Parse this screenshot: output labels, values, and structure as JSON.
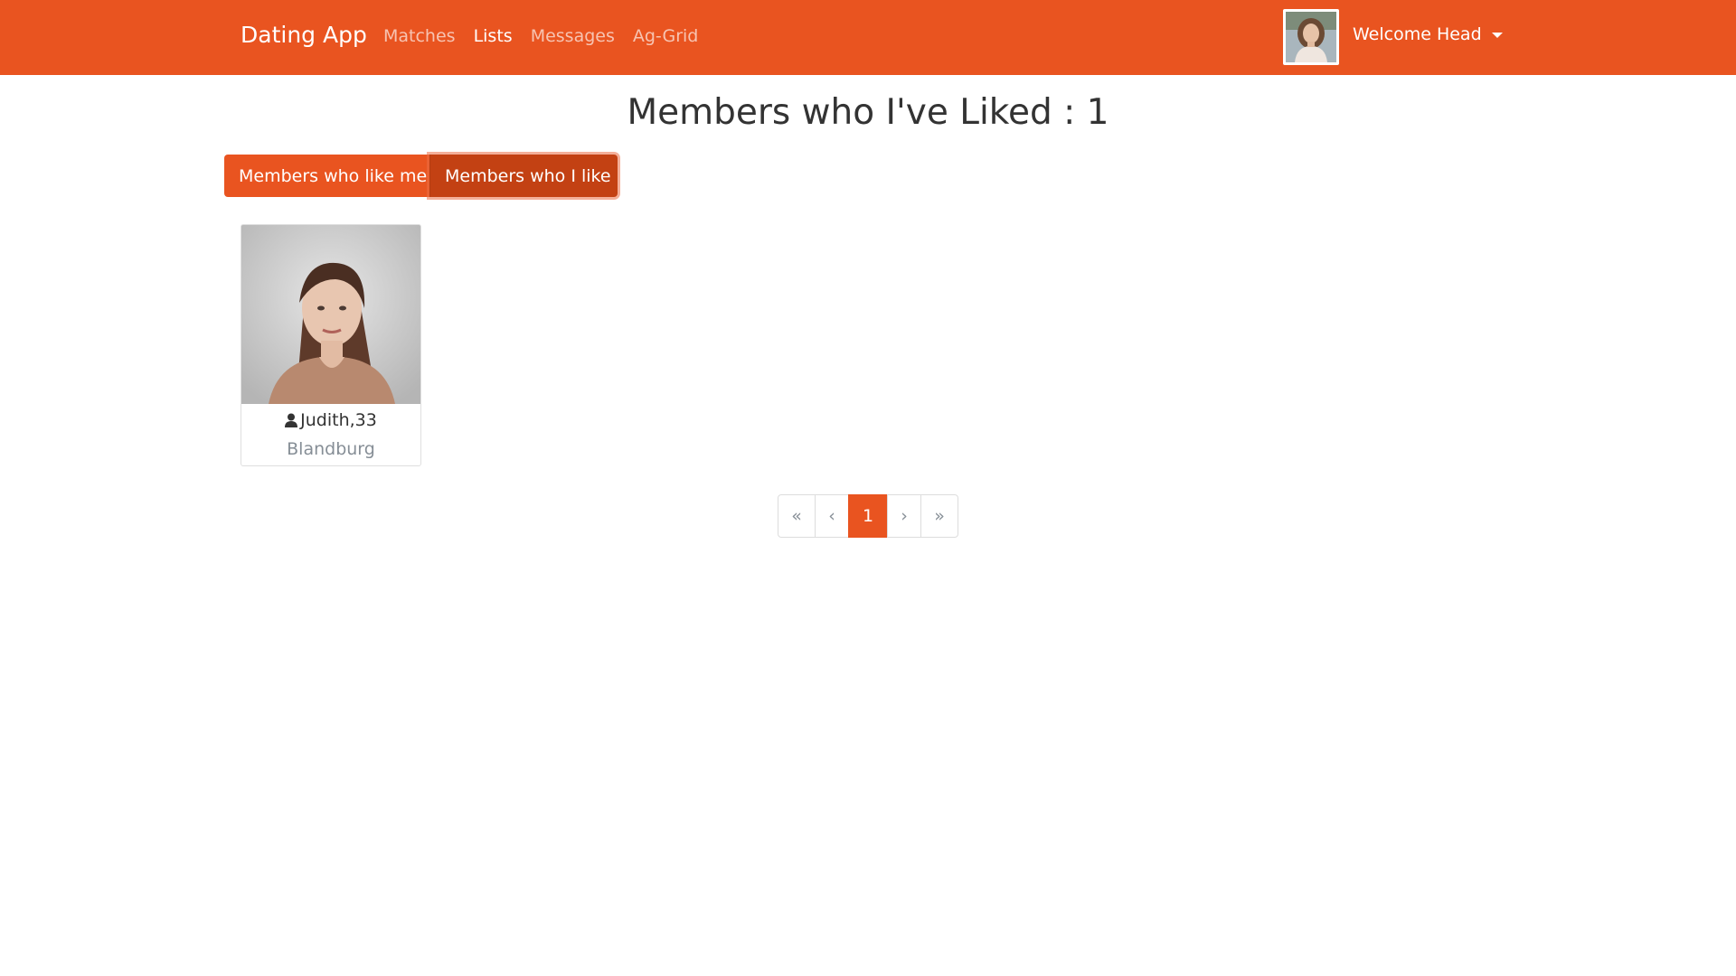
{
  "navbar": {
    "brand": "Dating App",
    "links": [
      {
        "label": "Matches",
        "active": false
      },
      {
        "label": "Lists",
        "active": true
      },
      {
        "label": "Messages",
        "active": false
      },
      {
        "label": "Ag-Grid",
        "active": false
      }
    ],
    "welcome": "Welcome Head",
    "accent_color": "#e95420"
  },
  "page": {
    "title": "Members who I've Liked : 1"
  },
  "toggle": {
    "like_me_label": "Members who like me",
    "i_like_label": "Members who I like",
    "selected": "Members who I like"
  },
  "members": [
    {
      "name_age": "Judith,33",
      "city": "Blandburg"
    }
  ],
  "pagination": {
    "first": "«",
    "prev": "‹",
    "current": "1",
    "next": "›",
    "last": "»"
  }
}
